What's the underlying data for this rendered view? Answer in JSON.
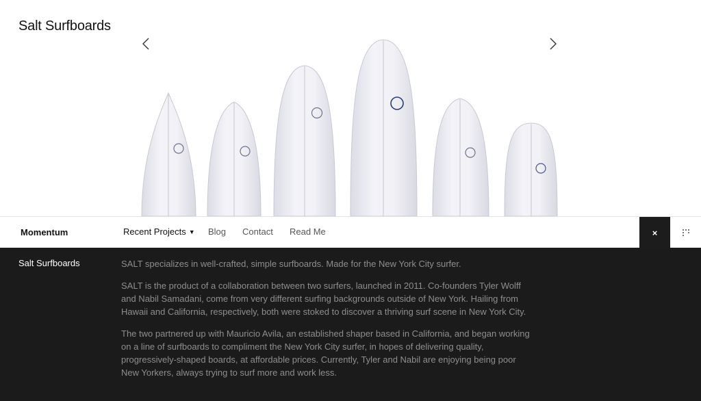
{
  "site": {
    "title": "Salt Surfboards"
  },
  "slider": {
    "prev_icon": "chevron-left-icon",
    "next_icon": "chevron-right-icon",
    "board_count": 6
  },
  "nav": {
    "brand": "Momentum",
    "links": [
      {
        "label": "Recent Projects",
        "has_dropdown": true
      },
      {
        "label": "Blog"
      },
      {
        "label": "Contact"
      },
      {
        "label": "Read Me"
      }
    ],
    "close_label": "×",
    "grid_icon": "dots-grid-icon"
  },
  "project": {
    "title": "Salt Surfboards",
    "paragraphs": [
      "SALT specializes in well-crafted, simple surfboards. Made for the New York City surfer.",
      "SALT is the product of a collaboration between two surfers, launched in 2011. Co-founders Tyler Wolff and Nabil Samadani, come from very different surfing backgrounds outside of New York. Hailing from Hawaii and California, respectively, both were stoked to discover a thriving surf scene in New York City.",
      "The two partnered up with Mauricio Avila, an established shaper based in California, and began working on a line of surfboards to compliment the New York City surfer, in hopes of delivering quality, progressively-shaped boards, at affordable prices. Currently, Tyler and Nabil are enjoying being poor New Yorkers, always trying to surf more and work less."
    ]
  },
  "colors": {
    "info_bg": "#1b1b1b",
    "info_text": "#8e8e8e",
    "board_fill": "#eaeaf1",
    "logo_blue": "#2c3e78"
  }
}
